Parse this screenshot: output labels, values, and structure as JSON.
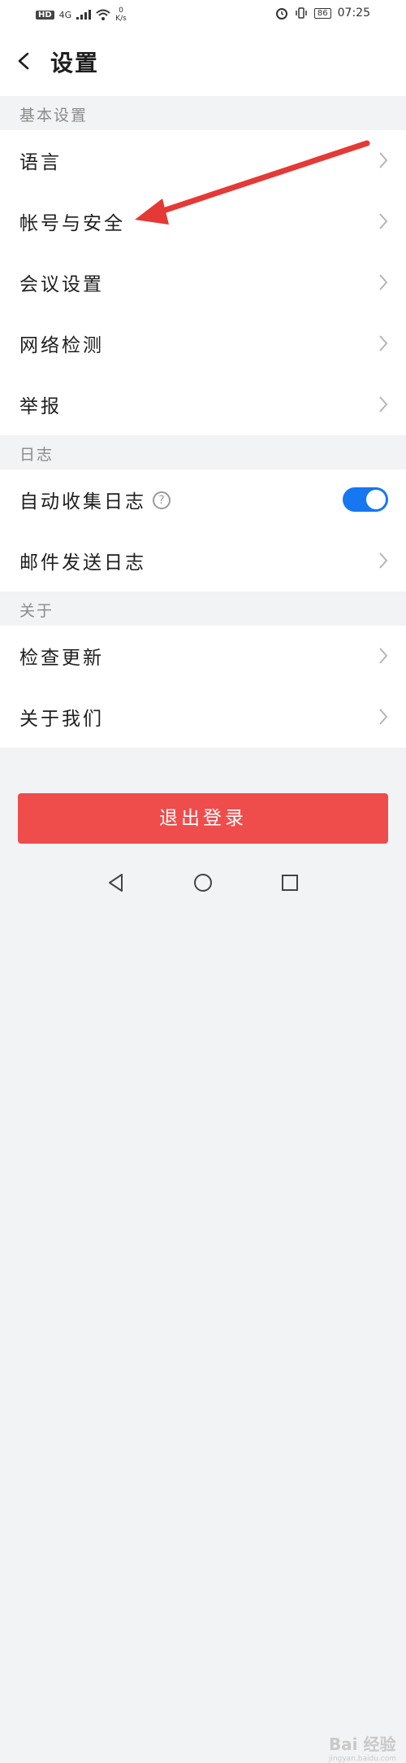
{
  "status_bar": {
    "hd": "HD",
    "network": "4G",
    "speed_value": "0",
    "speed_unit": "K/s",
    "battery": "86",
    "time": "07:25"
  },
  "header": {
    "title": "设置"
  },
  "sections": {
    "basic": "基本设置",
    "log": "日志",
    "about": "关于"
  },
  "items": {
    "language": "语言",
    "account_security": "帐号与安全",
    "meeting_settings": "会议设置",
    "network_check": "网络检测",
    "report": "举报",
    "auto_collect_log": "自动收集日志",
    "email_log": "邮件发送日志",
    "check_update": "检查更新",
    "about_us": "关于我们"
  },
  "auto_collect_log_enabled": true,
  "help_glyph": "?",
  "logout_label": "退出登录",
  "watermark": {
    "brand": "Bai 经验",
    "site": "jingyan.baidu.com"
  },
  "colors": {
    "accent_blue": "#1677f0",
    "logout_red": "#ef4c4c",
    "annotation_arrow": "#e53935"
  }
}
